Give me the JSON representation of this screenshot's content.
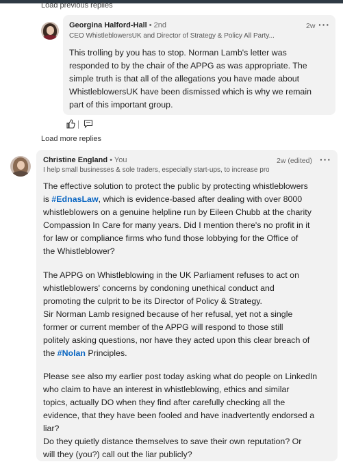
{
  "thread": {
    "load_previous_label": "Load previous replies",
    "load_more_label": "Load more replies"
  },
  "reply": {
    "author": "Georgina Halford-Hall",
    "degree": "• 2nd",
    "headline": "CEO WhistleblowersUK and Director of Strategy & Policy All Party...",
    "time": "2w",
    "more_icon": "ellipsis-icon",
    "text_lines": [
      "This trolling by you has to stop. Norman Lamb's letter was",
      "responded to by the chair of the APPG as was appropriate. The",
      "simple truth is that all of the allegations you have made about",
      "WhistleblowersUK have been dismissed which is why we remain",
      "part of this important group."
    ],
    "like_icon": "thumbs-up-icon",
    "reply_icon": "comment-icon"
  },
  "comment": {
    "author": "Christine England",
    "you_label": "• You",
    "headline": "I help small businesses & sole traders, especially start-ups, to increase pro...",
    "time": "2w (edited)",
    "more_icon": "ellipsis-icon",
    "paragraph1": {
      "line1": "The effective solution to protect the public by protecting whistleblowers",
      "line2_pre": "is ",
      "hashtag1": "#EdnasLaw",
      "line2_post": ", which is evidence-based after dealing with over 8000",
      "line3": "whistleblowers on a genuine helpline run by Eileen Chubb at the charity",
      "line4": "Compassion In Care for many years.  Did I mention there's no profit in it",
      "line5": "for law or compliance firms who fund those lobbying for the Office of",
      "line6": "the Whistleblower?"
    },
    "paragraph2": {
      "line1": "The APPG on Whistleblowing in the UK Parliament refuses to act on",
      "line2": "whistleblowers' concerns by condoning unethical conduct and",
      "line3": "promoting the culprit to be its Director of Policy & Strategy.",
      "line4": "Sir Norman Lamb resigned because of her refusal, yet not a single",
      "line5": "former or current member of the APPG will respond to those still",
      "line6": "politely asking questions, nor have they acted upon this clear breach of",
      "line7_pre": "the ",
      "hashtag2": "#Nolan",
      "line7_post": " Principles."
    },
    "paragraph3": {
      "line1": "Please see also my earlier post today asking what do people on LinkedIn",
      "line2": "who claim to have an interest in whistleblowing, ethics and similar",
      "line3": "topics, actually DO when they find after carefully checking all the",
      "line4": "evidence, that they have been fooled and have inadvertently endorsed a",
      "line5": "liar?",
      "line6": "Do they quietly distance themselves to save their own reputation?   Or",
      "line7": "will they (you?) call out the liar publicly?"
    }
  },
  "colors": {
    "bubble": "#f2f2f2",
    "hashtag": "#0a66c2",
    "topbar": "#2f3a44"
  }
}
